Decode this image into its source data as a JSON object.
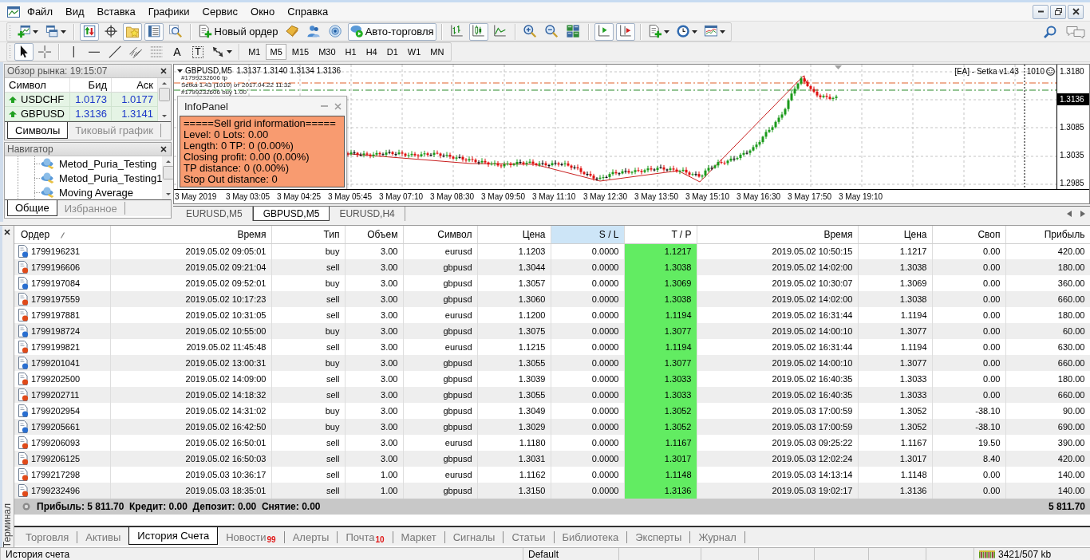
{
  "menu": {
    "items": [
      "Файл",
      "Вид",
      "Вставка",
      "Графики",
      "Сервис",
      "Окно",
      "Справка"
    ]
  },
  "toolbar": {
    "groups": [
      [
        {
          "kind": "new-chart",
          "dropdown": true,
          "pressed": false
        },
        {
          "kind": "profiles",
          "dropdown": true,
          "pressed": false
        }
      ],
      [
        {
          "kind": "market-watch",
          "dropdown": false,
          "pressed": true
        },
        {
          "kind": "data-window",
          "dropdown": false,
          "pressed": false
        },
        {
          "kind": "navigator",
          "dropdown": false,
          "pressed": true
        },
        {
          "kind": "terminal",
          "dropdown": false,
          "pressed": true
        },
        {
          "kind": "tester",
          "dropdown": false,
          "pressed": false
        }
      ],
      [
        {
          "kind": "new-order",
          "label": "Новый ордер",
          "dropdown": false,
          "pressed": false
        },
        {
          "kind": "metaeditor",
          "dropdown": false,
          "pressed": false
        },
        {
          "kind": "community",
          "dropdown": false,
          "pressed": false
        },
        {
          "kind": "signals",
          "dropdown": false,
          "pressed": false
        },
        {
          "kind": "auto-trading",
          "label": "Авто-торговля",
          "dropdown": false,
          "pressed": true
        }
      ],
      [
        {
          "kind": "bar-chart",
          "dropdown": false,
          "pressed": false
        },
        {
          "kind": "candles",
          "dropdown": false,
          "pressed": true
        },
        {
          "kind": "line-chart",
          "dropdown": false,
          "pressed": false
        }
      ],
      [
        {
          "kind": "zoom-in",
          "dropdown": false,
          "pressed": false
        },
        {
          "kind": "zoom-out",
          "dropdown": false,
          "pressed": false
        },
        {
          "kind": "tile",
          "dropdown": false,
          "pressed": false
        }
      ],
      [
        {
          "kind": "auto-scroll",
          "dropdown": false,
          "pressed": true
        },
        {
          "kind": "chart-shift",
          "dropdown": false,
          "pressed": true
        }
      ],
      [
        {
          "kind": "indicators",
          "dropdown": true,
          "pressed": false
        },
        {
          "kind": "periods",
          "dropdown": true,
          "pressed": false
        },
        {
          "kind": "templates",
          "dropdown": true,
          "pressed": false
        }
      ]
    ]
  },
  "drawing_tools": {
    "groups": [
      [
        {
          "kind": "cursor",
          "dropdown": false,
          "selected": true
        },
        {
          "kind": "crosshair",
          "dropdown": false,
          "selected": false
        }
      ],
      [
        {
          "kind": "vline",
          "dropdown": false,
          "selected": false
        },
        {
          "kind": "hline",
          "dropdown": false,
          "selected": false
        },
        {
          "kind": "trendline",
          "dropdown": false,
          "selected": false
        },
        {
          "kind": "channel",
          "dropdown": false,
          "selected": false
        },
        {
          "kind": "fibonacci",
          "dropdown": false,
          "selected": false
        },
        {
          "kind": "text",
          "glyph": "A",
          "dropdown": false,
          "selected": false
        },
        {
          "kind": "label",
          "glyph": "T",
          "dropdown": false,
          "selected": false
        },
        {
          "kind": "arrows",
          "dropdown": true,
          "selected": false
        }
      ]
    ]
  },
  "timeframes": [
    {
      "label": "M1",
      "selected": false
    },
    {
      "label": "M5",
      "selected": true
    },
    {
      "label": "M15",
      "selected": false
    },
    {
      "label": "M30",
      "selected": false
    },
    {
      "label": "H1",
      "selected": false
    },
    {
      "label": "H4",
      "selected": false
    },
    {
      "label": "D1",
      "selected": false
    },
    {
      "label": "W1",
      "selected": false
    },
    {
      "label": "MN",
      "selected": false
    }
  ],
  "market_watch": {
    "title": "Обзор рынка: 19:15:07",
    "columns": [
      "Символ",
      "Бид",
      "Аск"
    ],
    "rows": [
      {
        "symbol": "USDCHF",
        "bid": "1.0173",
        "ask": "1.0177",
        "rising": true
      },
      {
        "symbol": "GBPUSD",
        "bid": "1.3136",
        "ask": "1.3141",
        "rising": true
      }
    ],
    "tabs": [
      {
        "label": "Символы",
        "selected": true
      },
      {
        "label": "Тиковый график",
        "selected": false
      }
    ]
  },
  "navigator": {
    "title": "Навигатор",
    "items": [
      "Metod_Puria_Testing",
      "Metod_Puria_Testing1",
      "Moving Average"
    ],
    "tabs": [
      {
        "label": "Общие",
        "selected": true
      },
      {
        "label": "Избранное",
        "selected": false
      }
    ]
  },
  "chart": {
    "header": "GBPUSD,M5  1.3137 1.3140 1.3134 1.3136",
    "order_labels": [
      "#1799232606 tp",
      "Setka 1.43 (1010) от 2017.04.22 11:32",
      "#1799232606 buy 1.00"
    ],
    "expert": "[EA] - Setka v1.43",
    "expert_magic": "1010",
    "price_labels": [
      {
        "text": "1.3180",
        "current": false
      },
      {
        "text": "1.3136",
        "current": true
      },
      {
        "text": "1.3085",
        "current": false
      },
      {
        "text": "1.3035",
        "current": false
      },
      {
        "text": "1.2985",
        "current": false
      }
    ],
    "time_labels": [
      "3 May 2019",
      "3 May 03:05",
      "3 May 04:25",
      "3 May 05:45",
      "3 May 07:10",
      "3 May 08:30",
      "3 May 09:50",
      "3 May 11:10",
      "3 May 12:30",
      "3 May 13:50",
      "3 May 15:10",
      "3 May 16:30",
      "3 May 17:50",
      "3 May 19:10"
    ],
    "info_panel": {
      "title": "InfoPanel",
      "lines": [
        "=====Sell grid information=====",
        "Level: 0 Lots: 0.00",
        "Length: 0 TP: 0 (0.00%)",
        "Closing profit: 0.00 (0.00%)",
        "TP distance: 0 (0.00%)",
        "Stop Out distance: 0"
      ]
    },
    "tabs": [
      {
        "label": "EURUSD,M5",
        "selected": false
      },
      {
        "label": "GBPUSD,M5",
        "selected": true
      },
      {
        "label": "EURUSD,H4",
        "selected": false
      }
    ]
  },
  "terminal": {
    "title": "Терминал",
    "columns": [
      {
        "label": "Ордер",
        "sorted": true,
        "highlighted": false
      },
      {
        "label": "Время",
        "sorted": false,
        "highlighted": false
      },
      {
        "label": "Тип",
        "sorted": false,
        "highlighted": false
      },
      {
        "label": "Объем",
        "sorted": false,
        "highlighted": false
      },
      {
        "label": "Символ",
        "sorted": false,
        "highlighted": false
      },
      {
        "label": "Цена",
        "sorted": false,
        "highlighted": false
      },
      {
        "label": "S / L",
        "sorted": false,
        "highlighted": true
      },
      {
        "label": "T / P",
        "sorted": false,
        "highlighted": false
      },
      {
        "label": "Время",
        "sorted": false,
        "highlighted": false
      },
      {
        "label": "Цена",
        "sorted": false,
        "highlighted": false
      },
      {
        "label": "Своп",
        "sorted": false,
        "highlighted": false
      },
      {
        "label": "Прибыль",
        "sorted": false,
        "highlighted": false
      }
    ],
    "rows": [
      {
        "kind": "buy",
        "tp_hit": true,
        "cells": [
          "1799196231",
          "2019.05.02 09:05:01",
          "buy",
          "3.00",
          "eurusd",
          "1.1203",
          "0.0000",
          "1.1217",
          "2019.05.02 10:50:15",
          "1.1217",
          "0.00",
          "420.00"
        ]
      },
      {
        "kind": "sell",
        "tp_hit": true,
        "cells": [
          "1799196606",
          "2019.05.02 09:21:04",
          "sell",
          "3.00",
          "gbpusd",
          "1.3044",
          "0.0000",
          "1.3038",
          "2019.05.02 14:02:00",
          "1.3038",
          "0.00",
          "180.00"
        ]
      },
      {
        "kind": "buy",
        "tp_hit": true,
        "cells": [
          "1799197084",
          "2019.05.02 09:52:01",
          "buy",
          "3.00",
          "gbpusd",
          "1.3057",
          "0.0000",
          "1.3069",
          "2019.05.02 10:30:07",
          "1.3069",
          "0.00",
          "360.00"
        ]
      },
      {
        "kind": "sell",
        "tp_hit": true,
        "cells": [
          "1799197559",
          "2019.05.02 10:17:23",
          "sell",
          "3.00",
          "gbpusd",
          "1.3060",
          "0.0000",
          "1.3038",
          "2019.05.02 14:02:00",
          "1.3038",
          "0.00",
          "660.00"
        ]
      },
      {
        "kind": "sell",
        "tp_hit": true,
        "cells": [
          "1799197881",
          "2019.05.02 10:31:05",
          "sell",
          "3.00",
          "eurusd",
          "1.1200",
          "0.0000",
          "1.1194",
          "2019.05.02 16:31:44",
          "1.1194",
          "0.00",
          "180.00"
        ]
      },
      {
        "kind": "buy",
        "tp_hit": true,
        "cells": [
          "1799198724",
          "2019.05.02 10:55:00",
          "buy",
          "3.00",
          "gbpusd",
          "1.3075",
          "0.0000",
          "1.3077",
          "2019.05.02 14:00:10",
          "1.3077",
          "0.00",
          "60.00"
        ]
      },
      {
        "kind": "sell",
        "tp_hit": true,
        "cells": [
          "1799199821",
          "2019.05.02 11:45:48",
          "sell",
          "3.00",
          "eurusd",
          "1.1215",
          "0.0000",
          "1.1194",
          "2019.05.02 16:31:44",
          "1.1194",
          "0.00",
          "630.00"
        ]
      },
      {
        "kind": "buy",
        "tp_hit": true,
        "cells": [
          "1799201041",
          "2019.05.02 13:00:31",
          "buy",
          "3.00",
          "gbpusd",
          "1.3055",
          "0.0000",
          "1.3077",
          "2019.05.02 14:00:10",
          "1.3077",
          "0.00",
          "660.00"
        ]
      },
      {
        "kind": "sell",
        "tp_hit": true,
        "cells": [
          "1799202500",
          "2019.05.02 14:09:00",
          "sell",
          "3.00",
          "gbpusd",
          "1.3039",
          "0.0000",
          "1.3033",
          "2019.05.02 16:40:35",
          "1.3033",
          "0.00",
          "180.00"
        ]
      },
      {
        "kind": "sell",
        "tp_hit": true,
        "cells": [
          "1799202711",
          "2019.05.02 14:18:32",
          "sell",
          "3.00",
          "gbpusd",
          "1.3055",
          "0.0000",
          "1.3033",
          "2019.05.02 16:40:35",
          "1.3033",
          "0.00",
          "660.00"
        ]
      },
      {
        "kind": "buy",
        "tp_hit": true,
        "cells": [
          "1799202954",
          "2019.05.02 14:31:02",
          "buy",
          "3.00",
          "gbpusd",
          "1.3049",
          "0.0000",
          "1.3052",
          "2019.05.03 17:00:59",
          "1.3052",
          "-38.10",
          "90.00"
        ]
      },
      {
        "kind": "buy",
        "tp_hit": true,
        "cells": [
          "1799205661",
          "2019.05.02 16:42:50",
          "buy",
          "3.00",
          "gbpusd",
          "1.3029",
          "0.0000",
          "1.3052",
          "2019.05.03 17:00:59",
          "1.3052",
          "-38.10",
          "690.00"
        ]
      },
      {
        "kind": "sell",
        "tp_hit": true,
        "cells": [
          "1799206093",
          "2019.05.02 16:50:01",
          "sell",
          "3.00",
          "eurusd",
          "1.1180",
          "0.0000",
          "1.1167",
          "2019.05.03 09:25:22",
          "1.1167",
          "19.50",
          "390.00"
        ]
      },
      {
        "kind": "sell",
        "tp_hit": true,
        "cells": [
          "1799206125",
          "2019.05.02 16:50:03",
          "sell",
          "3.00",
          "gbpusd",
          "1.3031",
          "0.0000",
          "1.3017",
          "2019.05.03 12:02:24",
          "1.3017",
          "8.40",
          "420.00"
        ]
      },
      {
        "kind": "sell",
        "tp_hit": true,
        "cells": [
          "1799217298",
          "2019.05.03 10:36:17",
          "sell",
          "1.00",
          "eurusd",
          "1.1162",
          "0.0000",
          "1.1148",
          "2019.05.03 14:13:14",
          "1.1148",
          "0.00",
          "140.00"
        ]
      },
      {
        "kind": "sell",
        "tp_hit": true,
        "cells": [
          "1799232496",
          "2019.05.03 18:35:01",
          "sell",
          "1.00",
          "gbpusd",
          "1.3150",
          "0.0000",
          "1.3136",
          "2019.05.03 19:02:17",
          "1.3136",
          "0.00",
          "140.00"
        ]
      }
    ],
    "summary": {
      "text": "Прибыль: 5 811.70  Кредит: 0.00  Депозит: 0.00  Снятие: 0.00",
      "total": "5 811.70"
    },
    "tabs": [
      {
        "label": "Торговля",
        "selected": false
      },
      {
        "label": "Активы",
        "selected": false
      },
      {
        "label": "История Счета",
        "selected": true
      },
      {
        "label": "Новости",
        "badge": "99",
        "selected": false
      },
      {
        "label": "Алерты",
        "selected": false
      },
      {
        "label": "Почта",
        "badge": "10",
        "selected": false
      },
      {
        "label": "Маркет",
        "selected": false
      },
      {
        "label": "Сигналы",
        "selected": false
      },
      {
        "label": "Статьи",
        "selected": false
      },
      {
        "label": "Библиотека",
        "selected": false
      },
      {
        "label": "Эксперты",
        "selected": false
      },
      {
        "label": "Журнал",
        "selected": false
      }
    ]
  },
  "status_bar": {
    "sections": [
      "История счета",
      "Default"
    ],
    "traffic": "3421/507 kb"
  }
}
